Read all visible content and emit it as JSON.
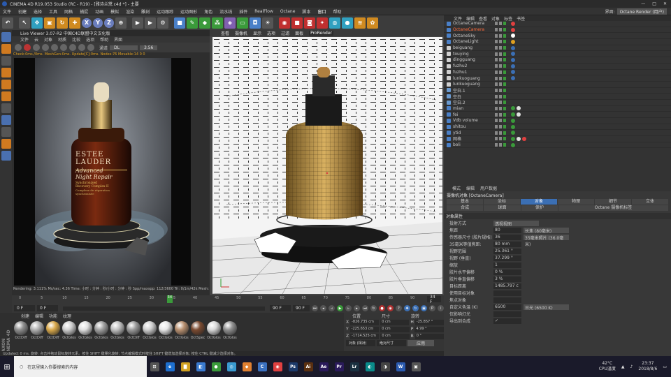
{
  "titlebar": {
    "title": "CINEMA 4D R19.053 Studio (RC - R19) - [雅诗兰黛.c4d *] - 主要",
    "controls": [
      "—",
      "□",
      "✕"
    ]
  },
  "menubar": {
    "items": [
      "文件",
      "创建",
      "选择",
      "工具",
      "网格",
      "捕捉",
      "动画",
      "模拟",
      "渲染",
      "雕刻",
      "运动跟踪",
      "运动图形",
      "角色",
      "流水线",
      "插件",
      "RealFlow",
      "Octane",
      "脚本",
      "窗口",
      "帮助"
    ],
    "layout_label": "界面:",
    "layout_value": "Octane Render (用户)"
  },
  "live_viewer": {
    "title": "Live Viewer 3.07-R2 中国C4D联盟中文汉化版",
    "menu": [
      "文件",
      "云",
      "对象",
      "材质",
      "比较",
      "选项",
      "帮助",
      "界面"
    ],
    "channel_label": "通道",
    "channel_value": "DL",
    "value_field": "3.56",
    "status": "Check:0ms./0ms. MeshGen:0ms. Update[C]:0ms. Nodes:76 Movable:14  0 0",
    "footer": "Rendering: 3.111%  Ms/sec: 4.36  Time: 小时 : 分钟 : 秒/小时 : 分钟 : 秒  Spp/maxspp: 112/3600  Tri: 0/1m/42k  Mesh: 20  Hair: 0",
    "bottle_text": [
      "ESTEE",
      "LAUDER",
      "Advanced",
      "Night Repair",
      "Synchronized",
      "Recovery Complex II",
      "Complexe de réparation",
      "synchronisée"
    ]
  },
  "viewport": {
    "menu": [
      "查看",
      "摄像机",
      "显示",
      "选项",
      "过滤",
      "面板"
    ],
    "renderer": "ProRender"
  },
  "timeline": {
    "ticks": [
      "0",
      "5",
      "10",
      "15",
      "20",
      "25",
      "30",
      "35",
      "40",
      "45",
      "50",
      "55",
      "60",
      "65",
      "70",
      "75",
      "80",
      "85",
      "90"
    ],
    "current": "34",
    "start": "0 F",
    "min": "0 F",
    "max": "90 F",
    "end": "90 F",
    "frame_display": "34 F",
    "playhead_fraction": 0.378
  },
  "materials": {
    "menu": [
      "创建",
      "编辑",
      "功能",
      "纹理"
    ],
    "brand": "MAXON CINEMA 4D",
    "items": [
      {
        "label": "OctDiff",
        "color": "#8e8e8e"
      },
      {
        "label": "OctDiff",
        "color": "#b0b0b0"
      },
      {
        "label": "OctDiff",
        "color": "#d8a84a"
      },
      {
        "label": "OctGlos",
        "color": "#cfcfcf"
      },
      {
        "label": "OctGlos",
        "color": "#e0e0e0"
      },
      {
        "label": "OctGlos",
        "color": "#a0a0a0"
      },
      {
        "label": "OctGlos",
        "color": "#c0c0c0"
      },
      {
        "label": "OctDiff",
        "color": "#9a9a9a"
      },
      {
        "label": "OctGlos",
        "color": "#d0d0d0"
      },
      {
        "label": "OctGlos",
        "color": "#e8e8e8"
      },
      {
        "label": "OctGlos",
        "color": "#b89070"
      },
      {
        "label": "OctSpec",
        "color": "#7a4a30"
      },
      {
        "label": "OctGlos",
        "color": "#d8d8d8"
      },
      {
        "label": "OctGlos",
        "color": "#909090"
      }
    ]
  },
  "coords": {
    "headers": [
      "位置",
      "尺寸",
      "旋转"
    ],
    "rows": [
      {
        "axis": "X",
        "pos": "-826.735 cm",
        "size": "0 cm",
        "rot_label": "H",
        "rot": "-25.857 °"
      },
      {
        "axis": "Y",
        "pos": "-225.653 cm",
        "size": "0 cm",
        "rot_label": "P",
        "rot": "4.99 °"
      },
      {
        "axis": "Z",
        "pos": "-1714.525 cm",
        "size": "0 cm",
        "rot_label": "B",
        "rot": "0 °"
      }
    ],
    "mode": "对象 (相对)",
    "size_mode": "绝对尺寸",
    "apply": "应用"
  },
  "object_manager": {
    "header": [
      "文件",
      "编辑",
      "查看",
      "对象",
      "标签",
      "书签"
    ],
    "objects": [
      {
        "name": "OctaneCamera",
        "icon": "#4a80c8",
        "selected": false,
        "tags": [
          "#e04040"
        ]
      },
      {
        "name": "OctaneCamera",
        "icon": "#4a80c8",
        "selected": true,
        "tags": [
          "#e04040"
        ]
      },
      {
        "name": "OctaneSky",
        "icon": "#4a80c8",
        "selected": false,
        "tags": [
          "#ffffff"
        ]
      },
      {
        "name": "OctaneLight",
        "icon": "#4a80c8",
        "selected": false,
        "tags": [
          "#e0a020"
        ]
      },
      {
        "name": "beiguang",
        "icon": "#d0d0d0",
        "selected": false,
        "tags": [
          "#3b6fb4"
        ]
      },
      {
        "name": "touying",
        "icon": "#d0d0d0",
        "selected": false,
        "tags": [
          "#3b6fb4"
        ]
      },
      {
        "name": "dingguang",
        "icon": "#d0d0d0",
        "selected": false,
        "tags": [
          "#3b6fb4"
        ]
      },
      {
        "name": "fuzhu2",
        "icon": "#d0d0d0",
        "selected": false,
        "tags": [
          "#3b6fb4"
        ]
      },
      {
        "name": "fuzhu1",
        "icon": "#d0d0d0",
        "selected": false,
        "tags": [
          "#3b6fb4"
        ]
      },
      {
        "name": "lunkuoguang",
        "icon": "#d0d0d0",
        "selected": false,
        "tags": [
          "#3b6fb4"
        ]
      },
      {
        "name": "lunkuoguang",
        "icon": "#d0d0d0",
        "selected": false,
        "tags": []
      },
      {
        "name": "空白.1",
        "icon": "#6a9ad0",
        "selected": false,
        "tags": []
      },
      {
        "name": "空白",
        "icon": "#6a9ad0",
        "selected": false,
        "tags": []
      },
      {
        "name": "空白.2",
        "icon": "#6a9ad0",
        "selected": false,
        "tags": []
      },
      {
        "name": "mian",
        "icon": "#4a80c8",
        "selected": false,
        "tags": [
          "#3a9a3a",
          "#e0e0e0"
        ]
      },
      {
        "name": "fei",
        "icon": "#4a80c8",
        "selected": false,
        "tags": [
          "#3a9a3a",
          "#e0e0e0"
        ]
      },
      {
        "name": "Vdb volume",
        "icon": "#4a80c8",
        "selected": false,
        "tags": [
          "#3a9a3a"
        ]
      },
      {
        "name": "shitou",
        "icon": "#4a80c8",
        "selected": false,
        "tags": [
          "#3a9a3a"
        ]
      },
      {
        "name": "ytid",
        "icon": "#4a80c8",
        "selected": false,
        "tags": [
          "#3a9a3a"
        ]
      },
      {
        "name": "网格",
        "icon": "#4a80c8",
        "selected": false,
        "tags": [
          "#3a9a3a",
          "#e0e0e0",
          "#e04040"
        ]
      },
      {
        "name": "boli",
        "icon": "#4a80c8",
        "selected": false,
        "tags": [
          "#3a9a3a"
        ]
      }
    ]
  },
  "attributes": {
    "menu": [
      "模式",
      "编辑",
      "用户数据"
    ],
    "title": "摄像机对象 [OctaneCamera]",
    "tabs_row1": [
      "基本",
      "坐标",
      "对象",
      "物理",
      "细节",
      "立体"
    ],
    "tabs_row2": [
      "合成",
      "球面",
      "保护",
      "Octane 摄像机标签"
    ],
    "active_tab": "对象",
    "section": "对象属性",
    "projection_label": "投射方式",
    "projection_value": "透视视图",
    "fields": [
      {
        "label": "焦距",
        "value": "80",
        "extra": "长焦 (80毫米)"
      },
      {
        "label": "传感器尺寸 (胶片规格)",
        "value": "36",
        "extra": "35毫米照片 (36.0毫米)"
      },
      {
        "label": "35毫米等值焦距:",
        "value": "80 mm",
        "extra": ""
      },
      {
        "label": "视野范围",
        "value": "25.361 °",
        "extra": ""
      },
      {
        "label": "视野 (垂直)",
        "value": "37.299 °",
        "extra": ""
      },
      {
        "label": "缩放",
        "value": "1",
        "extra": ""
      },
      {
        "label": "胶片水平偏移",
        "value": "0 %",
        "extra": ""
      },
      {
        "label": "胶片垂直偏移",
        "value": "3 %",
        "extra": ""
      },
      {
        "label": "目标距离",
        "value": "1485.797 c",
        "extra": ""
      },
      {
        "label": "使用目标对象",
        "value": "",
        "extra": ""
      },
      {
        "label": "焦点对象",
        "value": "",
        "extra": ""
      },
      {
        "label": "自定义色温 (K)",
        "value": "6500",
        "extra": "日光 (6500 K)"
      },
      {
        "label": "仅影响灯光",
        "value": "",
        "extra": ""
      },
      {
        "label": "导出到合成",
        "value": "✓",
        "extra": ""
      }
    ]
  },
  "statusbar": {
    "text": "Updated: 0 ms.    旋转: 点击并拖动鼠标旋转元素。按住 SHIFT 键量化旋转; 节点编辑模式时按住 SHIFT 键增加选择对象; 按住 CTRL 键减少选择对象。"
  },
  "taskbar": {
    "search_placeholder": "在这里输入你要搜索的内容",
    "apps": [
      {
        "label": "⊡",
        "color": "#555"
      },
      {
        "label": "e",
        "color": "#1e6fd0"
      },
      {
        "label": "▇",
        "color": "#d0a020"
      },
      {
        "label": "◧",
        "color": "#3a7ad0"
      },
      {
        "label": "●",
        "color": "#3a9a3a"
      },
      {
        "label": "◎",
        "color": "#3a9ad0"
      },
      {
        "label": "◆",
        "color": "#e08030"
      },
      {
        "label": "C",
        "color": "#3a70c0"
      },
      {
        "label": "◉",
        "color": "#e04040"
      },
      {
        "label": "Ps",
        "color": "#1c3a6a"
      },
      {
        "label": "Ai",
        "color": "#5a3010"
      },
      {
        "label": "Ae",
        "color": "#2a1a5a"
      },
      {
        "label": "Pr",
        "color": "#2a1a5a"
      },
      {
        "label": "Lr",
        "color": "#1a3040"
      },
      {
        "label": "◐",
        "color": "#0a8a8a"
      },
      {
        "label": "◑",
        "color": "#444"
      },
      {
        "label": "W",
        "color": "#2a5ab0"
      },
      {
        "label": "▣",
        "color": "#555"
      }
    ],
    "temp": "42°C",
    "temp_label": "CPU温度",
    "time": "23:37",
    "date": "2018/8/6"
  }
}
